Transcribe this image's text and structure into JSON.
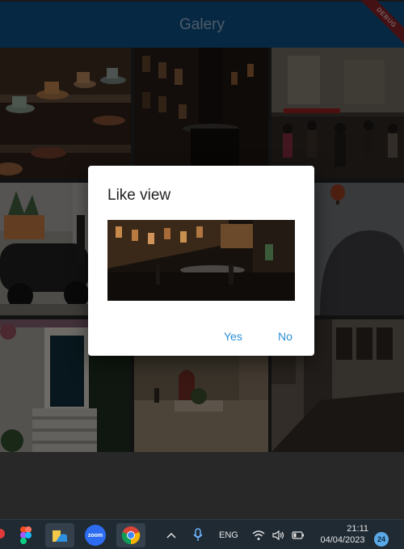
{
  "app": {
    "title": "Galery",
    "debug_banner": "DEBUG"
  },
  "gallery": {
    "photos": [
      {
        "icon": "cafe-cups-photo"
      },
      {
        "icon": "narrow-street-photo"
      },
      {
        "icon": "crowded-square-photo"
      },
      {
        "icon": "scooter-photo"
      },
      {
        "icon": "street-photo"
      },
      {
        "icon": "balloon-sky-photo"
      },
      {
        "icon": "green-door-photo"
      },
      {
        "icon": "courtyard-photo"
      },
      {
        "icon": "old-street-photo"
      }
    ]
  },
  "dialog": {
    "title": "Like view",
    "image_icon": "narrow-street-photo",
    "yes_label": "Yes",
    "no_label": "No",
    "accent_color": "#2a8fd6"
  },
  "taskbar": {
    "language": "ENG",
    "time": "21:11",
    "date": "04/04/2023",
    "notification_count": "24",
    "zoom_label": "zoom"
  },
  "colors": {
    "appbar": "#0d4a7a",
    "dialog_bg": "#ffffff"
  }
}
